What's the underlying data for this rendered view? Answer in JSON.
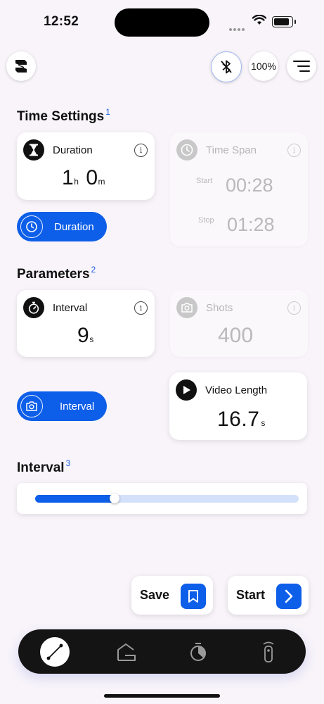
{
  "status_bar": {
    "time": "12:52"
  },
  "header": {
    "battery_label": "100%"
  },
  "time_settings": {
    "title": "Time Settings",
    "footnote": "1",
    "duration_card": {
      "label": "Duration",
      "hours": "1",
      "hours_unit": "h",
      "minutes": "0",
      "minutes_unit": "m"
    },
    "time_span_card": {
      "label": "Time Span",
      "start_label": "Start",
      "start_value": "00:28",
      "stop_label": "Stop",
      "stop_value": "01:28"
    },
    "mode_pill": {
      "label": "Duration"
    }
  },
  "parameters": {
    "title": "Parameters",
    "footnote": "2",
    "interval_card": {
      "label": "Interval",
      "value": "9",
      "unit": "s"
    },
    "shots_card": {
      "label": "Shots",
      "value": "400"
    },
    "mode_pill": {
      "label": "Interval"
    },
    "video_length_card": {
      "label": "Video Length",
      "value": "16.7",
      "unit": "s"
    }
  },
  "interval_slider": {
    "title": "Interval",
    "footnote": "3",
    "fill_fraction": 0.3
  },
  "actions": {
    "save_label": "Save",
    "start_label": "Start"
  },
  "tab_bar": {
    "tabs": [
      "timelapse",
      "home",
      "timer",
      "remote"
    ],
    "active": "timelapse"
  },
  "colors": {
    "accent": "#0d5ee8",
    "background": "#f8f4fa",
    "tabbar": "#141414"
  }
}
